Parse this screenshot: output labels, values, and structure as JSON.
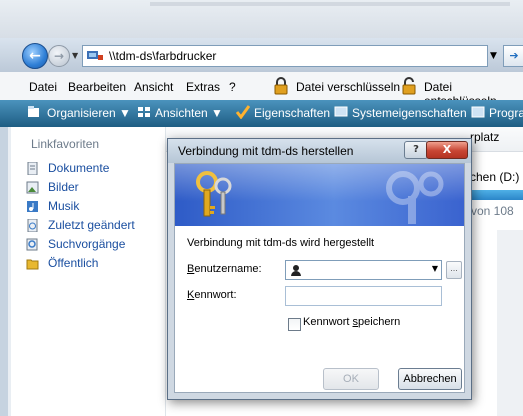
{
  "address_bar": {
    "path": "\\\\tdm-ds\\farbdrucker"
  },
  "menu": {
    "items": [
      "Datei",
      "Bearbeiten",
      "Ansicht",
      "Extras",
      "?"
    ],
    "encrypt": "Datei verschlüsseln",
    "decrypt": "Datei entschlüsseln"
  },
  "toolbar": {
    "organize": "Organisieren",
    "views": "Ansichten",
    "properties": "Eigenschaften",
    "system_properties": "Systemeigenschaften",
    "programs": "Progra"
  },
  "sidebar": {
    "header": "Linkfavoriten",
    "items": [
      {
        "label": "Dokumente",
        "icon": "documents-icon"
      },
      {
        "label": "Bilder",
        "icon": "pictures-icon"
      },
      {
        "label": "Musik",
        "icon": "music-icon"
      },
      {
        "label": "Zuletzt geändert",
        "icon": "recent-icon"
      },
      {
        "label": "Suchvorgänge",
        "icon": "searches-icon"
      },
      {
        "label": "Öffentlich",
        "icon": "public-folder-icon"
      }
    ]
  },
  "background_pane": {
    "header_partial": "rplatz",
    "drive_partial": "chen (D:)",
    "usage_partial": "von 108"
  },
  "dialog": {
    "title": "Verbindung mit tdm-ds herstellen",
    "help": "?",
    "close": "X",
    "connecting_text": "Verbindung mit tdm-ds wird hergestellt",
    "username_label": "Benutzername:",
    "password_label": "Kennwort:",
    "username_value": "",
    "password_value": "",
    "save_password_label": "Kennwort speichern",
    "browse": "...",
    "ok": "OK",
    "cancel": "Abbrechen"
  },
  "colors": {
    "toolbar": "#1e5d83",
    "banner": "#2e5bc7",
    "link": "#1b4fa0",
    "close_button": "#c84533"
  }
}
